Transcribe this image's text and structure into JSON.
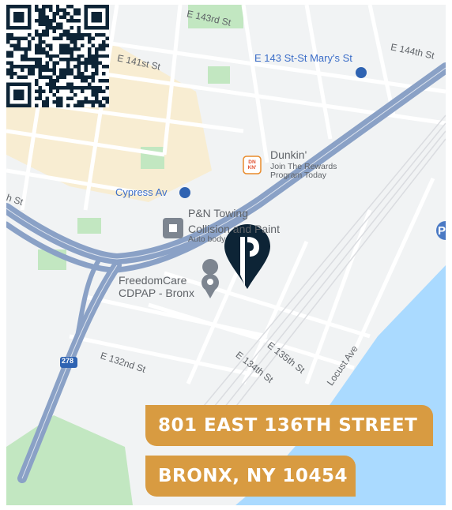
{
  "address": {
    "line1": "801 EAST 136TH STREET",
    "line2": "BRONX, NY 10454"
  },
  "map": {
    "streets": {
      "e143rd": "E 143rd St",
      "e141st": "E 141st St",
      "e144th": "E 144th St",
      "e132nd": "E 132nd St",
      "e134th": "E 134th St",
      "e135th": "E 135th St",
      "locust": "Locust Ave",
      "partial_st": "h St",
      "partial_st_top": "St",
      "route": "278"
    },
    "transit": {
      "st_marys": "E 143 St-St Mary's St",
      "cypress": "Cypress Av"
    },
    "pois": {
      "dunkin_name": "Dunkin'",
      "dunkin_sub1": "Join The Rewards",
      "dunkin_sub2": "Program Today",
      "dunkin_logo": "DN KN'",
      "pn_line1": "P&N Towing",
      "pn_line2": "Collision and Paint",
      "pn_line3": "Auto body",
      "freedom_line1": "FreedomCare",
      "freedom_line2": "CDPAP - Bronx",
      "parking_glyph": "P"
    },
    "colors": {
      "water": "#aadaff",
      "park": "#c2e7c1",
      "highway": "#8aa1c6",
      "banner": "#d89b41",
      "pin": "#0d2436"
    }
  },
  "icons": {
    "pin": "location-pin-icon",
    "transit": "subway-icon",
    "qr": "qr-code"
  }
}
